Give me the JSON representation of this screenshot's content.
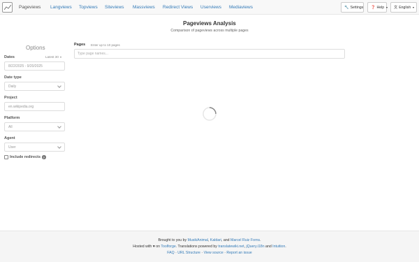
{
  "navbar": {
    "brand": "Pageviews",
    "links": [
      "Langviews",
      "Topviews",
      "Siteviews",
      "Massviews",
      "Redirect Views",
      "Userviews",
      "Mediaviews"
    ],
    "settings_label": "Settings",
    "help_label": "Help",
    "language_label": "English"
  },
  "header": {
    "title": "Pageviews Analysis",
    "subtitle": "Comparison of pageviews across multiple pages"
  },
  "sidebar": {
    "title": "Options",
    "dates_label": "Dates",
    "dates_latest": "Latest 30",
    "dates_value": "8/22/2025 - 9/20/2025",
    "date_type_label": "Date type",
    "date_type_value": "Daily",
    "project_label": "Project",
    "project_value": "en.wikipedia.org",
    "platform_label": "Platform",
    "platform_value": "All",
    "agent_label": "Agent",
    "agent_value": "User",
    "redirects_label": "Include redirects"
  },
  "pages": {
    "label": "Pages",
    "hint": "Enter up to 10 pages",
    "placeholder": "Type page names..."
  },
  "footer": {
    "line1_prefix": "Brought to you by",
    "author1": "MusikAnimal",
    "author2": "Kaldari",
    "line1_and": ", and",
    "author3": "Marcel Ruiz Forns",
    "line2_prefix": "Hosted with ♥ on",
    "toolforge": "Toolforge",
    "line2_mid": ". Translations powered by",
    "translatewiki": "translatewiki.net",
    "jquery": "jQuery.i18n",
    "line2_and": "and",
    "intuition": "Intuition",
    "faq": "FAQ",
    "url_structure": "URL Structure",
    "view_source": "View source",
    "report_issue": "Report an issue",
    "separator": "·"
  }
}
